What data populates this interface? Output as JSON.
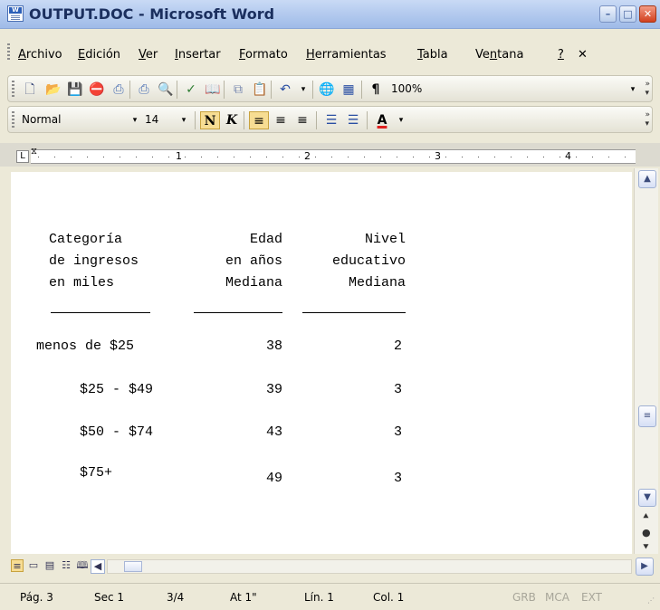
{
  "window": {
    "title": "OUTPUT.DOC - Microsoft Word",
    "app_icon_letter": "W",
    "minimize_symbol": "–",
    "maximize_symbol": "□",
    "close_symbol": "✕"
  },
  "menubar": {
    "items": [
      {
        "label": "Archivo",
        "accel": "A",
        "rest": "rchivo"
      },
      {
        "label": "Edición",
        "accel": "E",
        "rest": "dición"
      },
      {
        "label": "Ver",
        "accel": "V",
        "rest": "er"
      },
      {
        "label": "Insertar",
        "accel": "I",
        "rest": "nsertar"
      },
      {
        "label": "Formato",
        "accel": "F",
        "rest": "ormato"
      },
      {
        "label": "Herramientas",
        "accel": "H",
        "rest": "erramientas"
      },
      {
        "label": "Tabla",
        "accel": "T",
        "rest": "abla"
      },
      {
        "label": "Ventana",
        "pre": "Ve",
        "accel": "n",
        "rest": "tana"
      },
      {
        "label": "?",
        "accel": "?",
        "rest": ""
      }
    ],
    "close_doc": "✕"
  },
  "standard_toolbar": {
    "zoom": "100%",
    "icons": [
      "new-document-icon",
      "open-folder-icon",
      "save-icon",
      "permission-icon",
      "print-preview-icon",
      "print-icon",
      "spelling-icon",
      "research-icon",
      "copy-icon",
      "paste-icon",
      "undo-icon",
      "hyperlink-icon",
      "table-icon",
      "show-formatting-icon"
    ]
  },
  "formatting_toolbar": {
    "style": "Normal",
    "font_size": "14",
    "bold": "N",
    "italic": "K",
    "font_color_letter": "A",
    "font_color": "#e02020",
    "active_alignment": "left"
  },
  "ruler": {
    "numbers": [
      "1",
      "2",
      "3",
      "4"
    ],
    "tab_selector": "L"
  },
  "document": {
    "headers": {
      "col1": [
        "Categoría",
        "de ingresos",
        "en miles"
      ],
      "col2": [
        "Edad",
        "en años",
        "Mediana"
      ],
      "col3": [
        "Nivel",
        "educativo",
        "Mediana"
      ]
    },
    "rows": [
      {
        "category": "menos de $25",
        "age": "38",
        "level": "2"
      },
      {
        "category": "$25 - $49",
        "age": "39",
        "level": "3"
      },
      {
        "category": "$50 - $74",
        "age": "43",
        "level": "3"
      },
      {
        "category": "$75+",
        "age": "49",
        "level": "3"
      }
    ]
  },
  "statusbar": {
    "page": "Pág. 3",
    "section": "Sec 1",
    "pages": "3/4",
    "at": "At 1\"",
    "line": "Lín. 1",
    "col": "Col. 1",
    "grb": "GRB",
    "mca": "MCA",
    "ext": "EXT"
  }
}
